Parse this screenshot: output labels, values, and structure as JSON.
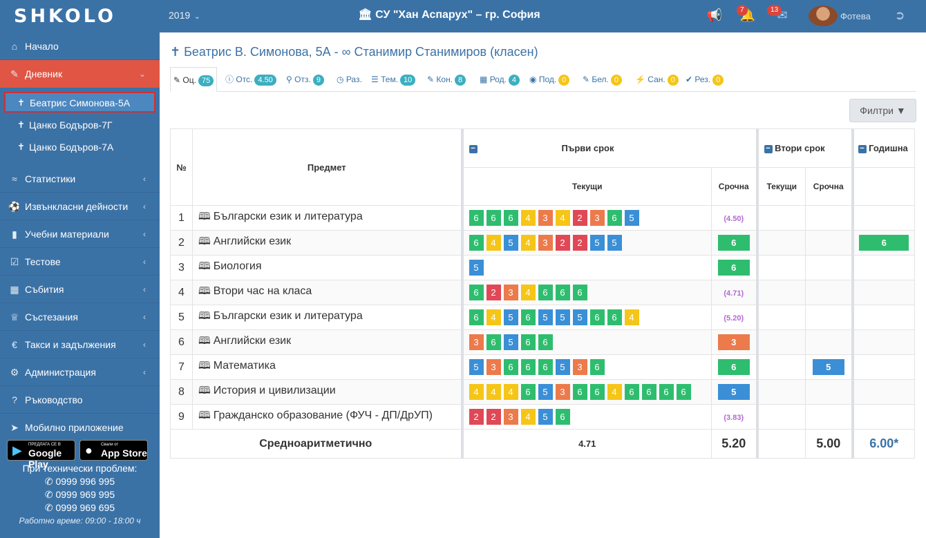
{
  "topbar": {
    "logo": "SHKOLO",
    "year": "2019",
    "school": "СУ \"Хан Аспарух\" – гр. София",
    "notifications_count": "7",
    "messages_count": "13",
    "user_name": "Фотева"
  },
  "sidebar": {
    "items": [
      {
        "label": "Начало",
        "icon": "home-icon"
      },
      {
        "label": "Дневник",
        "icon": "edit-icon"
      },
      {
        "label": "Статистики",
        "icon": "line-chart-icon"
      },
      {
        "label": "Извънкласни дейности",
        "icon": "soccer-ball-icon"
      },
      {
        "label": "Учебни материали",
        "icon": "book-icon"
      },
      {
        "label": "Тестове",
        "icon": "checkbox-icon"
      },
      {
        "label": "Събития",
        "icon": "calendar-icon"
      },
      {
        "label": "Състезания",
        "icon": "trophy-icon"
      },
      {
        "label": "Такси и задължения",
        "icon": "euro-icon"
      },
      {
        "label": "Администрация",
        "icon": "cogs-icon"
      },
      {
        "label": "Ръководство",
        "icon": "question-icon"
      },
      {
        "label": "Мобилно приложение",
        "icon": "rocket-icon"
      }
    ],
    "students": [
      {
        "label": "Беатрис Симонова-5А"
      },
      {
        "label": "Цанко Бодъров-7Г"
      },
      {
        "label": "Цанко Бодъров-7А"
      }
    ],
    "google_play": {
      "small": "ПРЕДЛАГА СЕ В",
      "big": "Google Play"
    },
    "app_store": {
      "small": "Свали от",
      "big": "App Store"
    },
    "support_title": "При технически проблем:",
    "phones": [
      "0999 996 995",
      "0999 969 995",
      "0999 969 695"
    ],
    "hours": "Работно време: 09:00 - 18:00 ч"
  },
  "main": {
    "student_name": "Беатрис В. Симонова, 5А -",
    "teacher": "Станимир Станимиров (класен)",
    "tabs": [
      {
        "label": "Оц.",
        "count": "75",
        "color": "teal"
      },
      {
        "label": "Отс.",
        "count": "4.50",
        "color": "teal"
      },
      {
        "label": "Отз.",
        "count": "9",
        "color": "teal"
      },
      {
        "label": "Раз.",
        "count": "",
        "color": ""
      },
      {
        "label": "Тем.",
        "count": "10",
        "color": "teal"
      },
      {
        "label": "Кон.",
        "count": "8",
        "color": "teal"
      },
      {
        "label": "Род.",
        "count": "4",
        "color": "teal"
      },
      {
        "label": "Под.",
        "count": "0",
        "color": "yellow"
      },
      {
        "label": "Бел.",
        "count": "0",
        "color": "yellow"
      },
      {
        "label": "Сан.",
        "count": "0",
        "color": "yellow"
      },
      {
        "label": "Рез.",
        "count": "0",
        "color": "yellow"
      }
    ],
    "filters_label": "Филтри"
  },
  "table": {
    "headers": {
      "num": "№",
      "subject": "Предмет",
      "term1": "Първи срок",
      "term2": "Втори срок",
      "annual": "Годишна",
      "current": "Текущи",
      "term_grade": "Срочна"
    },
    "rows": [
      {
        "n": "1",
        "subject": "Български език и литература",
        "t1_current": [
          6,
          6,
          6,
          4,
          3,
          4,
          2,
          3,
          6,
          5
        ],
        "t1_term": "(4.50)",
        "t1_term_final": false,
        "t2_term": "",
        "annual": ""
      },
      {
        "n": "2",
        "subject": "Английски език",
        "t1_current": [
          6,
          4,
          5,
          4,
          3,
          2,
          2,
          5,
          5
        ],
        "t1_term": "6",
        "t1_term_final": true,
        "t2_term": "",
        "annual": "6"
      },
      {
        "n": "3",
        "subject": "Биология",
        "t1_current": [
          5
        ],
        "t1_term": "6",
        "t1_term_final": true,
        "t2_term": "",
        "annual": ""
      },
      {
        "n": "4",
        "subject": "Втори час на класа",
        "t1_current": [
          6,
          2,
          3,
          4,
          6,
          6,
          6
        ],
        "t1_term": "(4.71)",
        "t1_term_final": false,
        "t2_term": "",
        "annual": ""
      },
      {
        "n": "5",
        "subject": "Български език и литература",
        "t1_current": [
          6,
          4,
          5,
          6,
          5,
          5,
          5,
          6,
          6,
          4
        ],
        "t1_term": "(5.20)",
        "t1_term_final": false,
        "t2_term": "",
        "annual": ""
      },
      {
        "n": "6",
        "subject": "Английски език",
        "t1_current": [
          3,
          6,
          5,
          6,
          6
        ],
        "t1_term": "3",
        "t1_term_final": true,
        "t2_term": "",
        "annual": ""
      },
      {
        "n": "7",
        "subject": "Математика",
        "t1_current": [
          5,
          3,
          6,
          6,
          6,
          5,
          3,
          6
        ],
        "t1_term": "6",
        "t1_term_final": true,
        "t2_term": "5",
        "annual": ""
      },
      {
        "n": "8",
        "subject": "История и цивилизации",
        "t1_current": [
          4,
          4,
          4,
          6,
          5,
          3,
          6,
          6,
          4,
          6,
          6,
          6,
          6
        ],
        "t1_term": "5",
        "t1_term_final": true,
        "t2_term": "",
        "annual": ""
      },
      {
        "n": "9",
        "subject": "Гражданско образование (ФУЧ - ДП/ДрУП)",
        "t1_current": [
          2,
          2,
          3,
          4,
          5,
          6
        ],
        "t1_term": "(3.83)",
        "t1_term_final": false,
        "t2_term": "",
        "annual": ""
      }
    ],
    "footer": {
      "label": "Средноаритметично",
      "t1_current_avg": "4.71",
      "t1_term_avg": "5.20",
      "t2_term_avg": "5.00",
      "annual_avg": "6.00*"
    }
  },
  "colors": {
    "primary": "#3b72a6",
    "active_nav": "#e05543",
    "grade6": "#2ebd6e",
    "grade5": "#3a8fd6",
    "grade4": "#f5c518",
    "grade3": "#ec7a4b",
    "grade2": "#e04856"
  }
}
